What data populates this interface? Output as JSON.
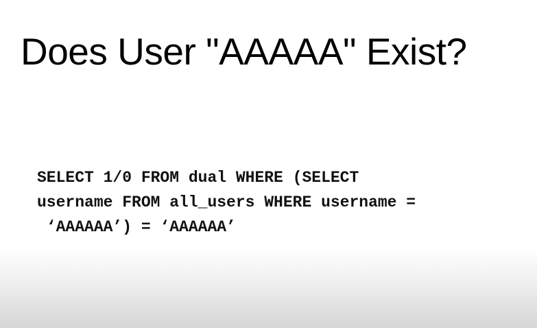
{
  "slide": {
    "title": "Does User \"AAAAA\" Exist?",
    "code_lines": [
      "SELECT 1/0 FROM dual WHERE (SELECT",
      "username FROM all_users WHERE username =",
      " ‘AAAAAA’) = ‘AAAAAA’"
    ]
  },
  "colors": {
    "background": "#ffffff",
    "text": "#000000",
    "bottom_fade": "#d6d6d6"
  }
}
